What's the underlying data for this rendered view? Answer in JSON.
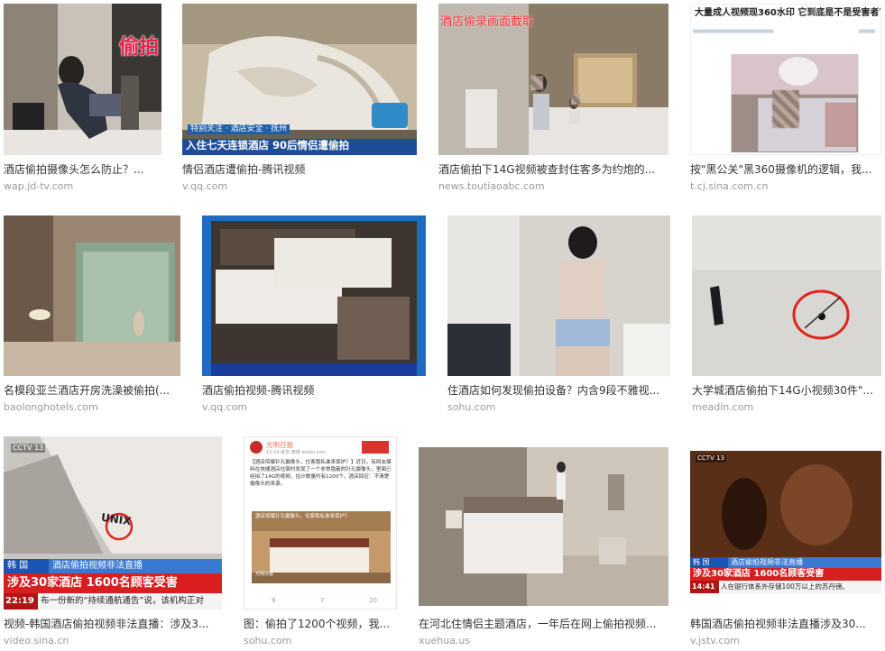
{
  "results": [
    {
      "caption": "酒店偷拍摄像头怎么防止？...",
      "source": "wap.jd-tv.com",
      "overlay": [
        "偷拍"
      ]
    },
    {
      "caption": "情侣酒店遭偷拍-腾讯视频",
      "source": "v.qq.com",
      "overlay": [
        "特别关注 · 酒店安全 · 抚州",
        "入住七天连锁酒店  90后情侣遭偷拍"
      ]
    },
    {
      "caption": "酒店偷拍下14G视频被查封住客多为约炮的...",
      "source": "news.toutiaoabc.com",
      "overlay": [
        "酒店偷录画面截取"
      ]
    },
    {
      "caption": "按\"黑公关\"黑360摄像机的逻辑，我...",
      "source": "t.cj.sina.com.cn",
      "overlay": [
        "大量成人视频现360水印 它到底是不是受害者？"
      ]
    },
    {
      "caption": "名模段亚兰酒店开房洗澡被偷拍(...",
      "source": "baolonghotels.com",
      "overlay": []
    },
    {
      "caption": "酒店偷拍视频-腾讯视频",
      "source": "v.qq.com",
      "overlay": []
    },
    {
      "caption": "住酒店如何发现偷拍设备？内含9段不雅视...",
      "source": "sohu.com",
      "overlay": []
    },
    {
      "caption": "大学城酒店偷拍下14G小视频30件\"...",
      "source": "meadin.com",
      "overlay": []
    },
    {
      "caption": "视频-韩国酒店偷拍视频非法直播：涉及3...",
      "source": "video.sina.cn",
      "overlay": [
        "CCTV 13",
        "UNIX",
        "韩 国",
        "酒店偷拍视频非法直播",
        "涉及30家酒店 1600名顾客受害",
        "22:19",
        "布一份新的“持续通航通告”说，该机构正对"
      ]
    },
    {
      "caption": "图：偷拍了1200个视频，我...",
      "source": "sohu.com",
      "overlay": [
        "光明日报",
        "【酒店惊曝针孔摄像头，住客隐私谁来保护？】近日，有网友爆料在快捷酒店住宿时发现了一个非常隐蔽的针孔摄像头，里面已经拍了14G的视频，估计数量约有1200个。酒店回应：不清楚摄像头的来源。",
        "12-24 来自 微博 weibo.com",
        "酒店惊曝针孔摄像头，住客隐私谁来保护？",
        "光明日报",
        "9",
        "7",
        "20"
      ]
    },
    {
      "caption": "在河北住情侣主题酒店，一年后在网上偷拍视频...",
      "source": "xuehua.us",
      "overlay": []
    },
    {
      "caption": "韩国酒店偷拍视频非法直播涉及30...",
      "source": "v.jstv.com",
      "overlay": [
        "CCTV 13",
        "韩 国",
        "酒店偷拍视频非法直播",
        "涉及30家酒店 1600名顾客受害",
        "14:41",
        "人在银行体系外存储100万以上的苏丹镑。"
      ]
    }
  ]
}
